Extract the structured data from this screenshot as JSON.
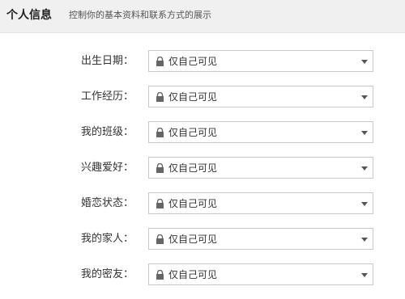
{
  "header": {
    "title": "个人信息",
    "description": "控制你的基本资料和联系方式的展示"
  },
  "fields": [
    {
      "label": "出生日期：",
      "value": "仅自己可见"
    },
    {
      "label": "工作经历：",
      "value": "仅自己可见"
    },
    {
      "label": "我的班级：",
      "value": "仅自己可见"
    },
    {
      "label": "兴趣爱好：",
      "value": "仅自己可见"
    },
    {
      "label": "婚恋状态：",
      "value": "仅自己可见"
    },
    {
      "label": "我的家人：",
      "value": "仅自己可见"
    },
    {
      "label": "我的密友：",
      "value": "仅自己可见"
    }
  ]
}
